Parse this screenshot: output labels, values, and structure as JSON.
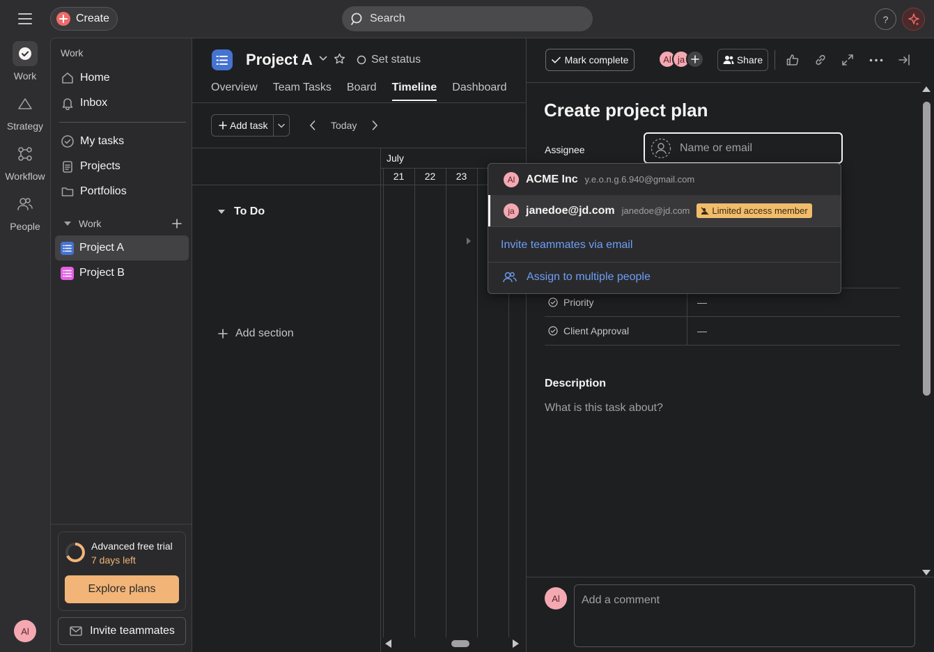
{
  "topbar": {
    "create_label": "Create",
    "search_placeholder": "Search",
    "help_label": "?"
  },
  "rail": {
    "items": [
      {
        "label": "Work",
        "icon": "check-circle-icon"
      },
      {
        "label": "Strategy",
        "icon": "triangle-icon"
      },
      {
        "label": "Workflow",
        "icon": "workflow-icon"
      },
      {
        "label": "People",
        "icon": "people-icon"
      }
    ],
    "user_initials": "Al"
  },
  "sidebar": {
    "section_work": "Work",
    "home": "Home",
    "inbox": "Inbox",
    "my_tasks": "My tasks",
    "projects": "Projects",
    "portfolios": "Portfolios",
    "work_group": "Work",
    "project_a": "Project A",
    "project_b": "Project B",
    "trial_title": "Advanced free trial",
    "trial_days": "7 days left",
    "explore_label": "Explore plans",
    "invite_label": "Invite teammates",
    "colors": {
      "project_a": "#4573d2",
      "project_b": "#e362e3",
      "trial_accent": "#f2b577"
    }
  },
  "main": {
    "project_title": "Project A",
    "set_status": "Set status",
    "tabs": [
      "Overview",
      "Team Tasks",
      "Board",
      "Timeline",
      "Dashboard"
    ],
    "active_tab": "Timeline",
    "add_task": "Add task",
    "today": "Today",
    "month": "July",
    "days": [
      "21",
      "22",
      "23"
    ],
    "section_todo": "To Do",
    "add_section": "Add section"
  },
  "detail": {
    "mark_complete": "Mark complete",
    "collaborators": [
      "Al",
      "ja"
    ],
    "share": "Share",
    "task_title": "Create project plan",
    "assignee_label": "Assignee",
    "assignee_placeholder": "Name or email",
    "fields": [
      {
        "label": "Priority",
        "value": "—"
      },
      {
        "label": "Client Approval",
        "value": "—"
      }
    ],
    "description_label": "Description",
    "description_placeholder": "What is this task about?",
    "comment_placeholder": "Add a comment",
    "comment_avatar": "Al"
  },
  "dropdown": {
    "options": [
      {
        "initials": "Al",
        "name": "ACME Inc",
        "email": "y.e.o.n.g.6.940@gmail.com"
      },
      {
        "initials": "ja",
        "name": "janedoe@jd.com",
        "email": "janedoe@jd.com",
        "badge": "Limited access member"
      }
    ],
    "invite_link": "Invite teammates via email",
    "assign_multiple": "Assign to multiple people"
  }
}
